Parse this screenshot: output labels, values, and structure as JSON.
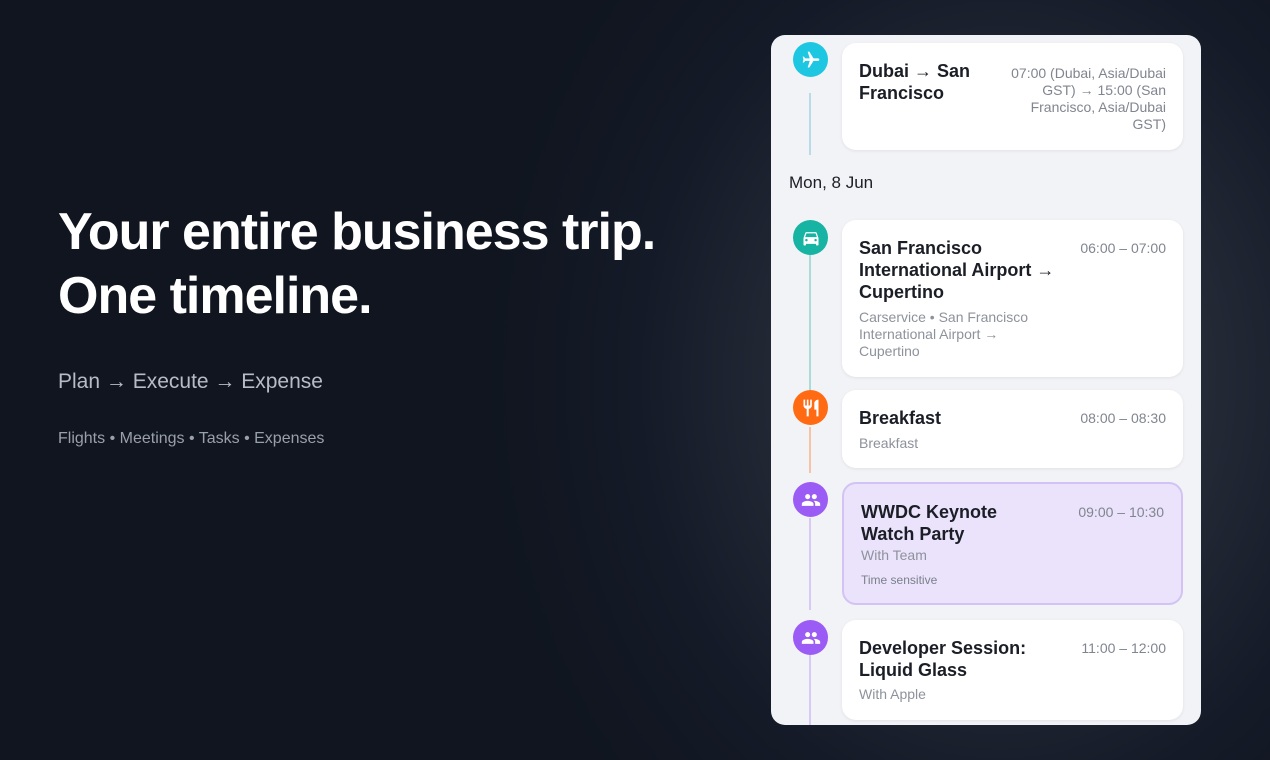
{
  "hero": {
    "title_line1": "Your entire business trip.",
    "title_line2": "One timeline.",
    "subtitle": "Plan → Execute → Expense",
    "tags": "Flights • Meetings • Tasks • Expenses"
  },
  "timeline": {
    "day_header": "Mon, 8 Jun",
    "events": [
      {
        "icon": "airplane-icon",
        "icon_color": "#1ec7e1",
        "title": "Dubai → San Francisco",
        "time": "07:00 (Dubai, Asia/Dubai GST) → 15:00 (San Francisco, Asia/Dubai GST)",
        "subtitle": ""
      },
      {
        "icon": "car-icon",
        "icon_color": "#17b3a3",
        "title": "San Francisco International Airport → Cupertino",
        "time": "06:00 – 07:00",
        "subtitle": "Carservice • San Francisco International Airport → Cupertino"
      },
      {
        "icon": "fork-knife-icon",
        "icon_color": "#ff6a13",
        "title": "Breakfast",
        "time": "08:00 – 08:30",
        "subtitle": "Breakfast"
      },
      {
        "icon": "people-icon",
        "icon_color": "#9b5cf5",
        "title": "WWDC Keynote Watch Party",
        "time": "09:00 – 10:30",
        "subtitle": "With Team",
        "badge": "Time sensitive"
      },
      {
        "icon": "people-icon",
        "icon_color": "#9b5cf5",
        "title": "Developer Session: Liquid Glass",
        "time": "11:00 – 12:00",
        "subtitle": "With Apple"
      }
    ]
  }
}
